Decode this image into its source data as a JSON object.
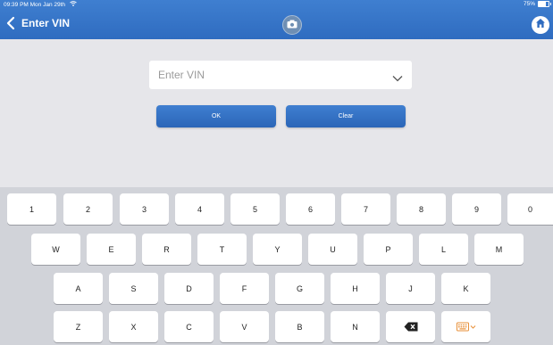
{
  "status_bar": {
    "time": "09:39 PM  Mon Jan 29th",
    "battery_percent": "75%",
    "battery_level": 0.75,
    "wifi_icon": "wifi-icon"
  },
  "header": {
    "title": "Enter VIN",
    "back_icon": "back-chevron-icon",
    "camera_icon": "camera-icon",
    "home_icon": "home-icon",
    "color": "#2f6cc0"
  },
  "vin_input": {
    "placeholder": "Enter VIN",
    "value": "",
    "dropdown_icon": "chevron-down-icon"
  },
  "buttons": {
    "ok_label": "OK",
    "clear_label": "Clear"
  },
  "keyboard": {
    "row1": [
      "1",
      "2",
      "3",
      "4",
      "5",
      "6",
      "7",
      "8",
      "9",
      "0"
    ],
    "row2": [
      "W",
      "E",
      "R",
      "T",
      "Y",
      "U",
      "P",
      "L",
      "M"
    ],
    "row3": [
      "A",
      "S",
      "D",
      "F",
      "G",
      "H",
      "J",
      "K"
    ],
    "row4": [
      "Z",
      "X",
      "C",
      "V",
      "B",
      "N"
    ],
    "delete_icon": "backspace-icon",
    "keyboard_icon": "keyboard-hide-icon",
    "keyboard_icon_color": "#e8913a"
  }
}
